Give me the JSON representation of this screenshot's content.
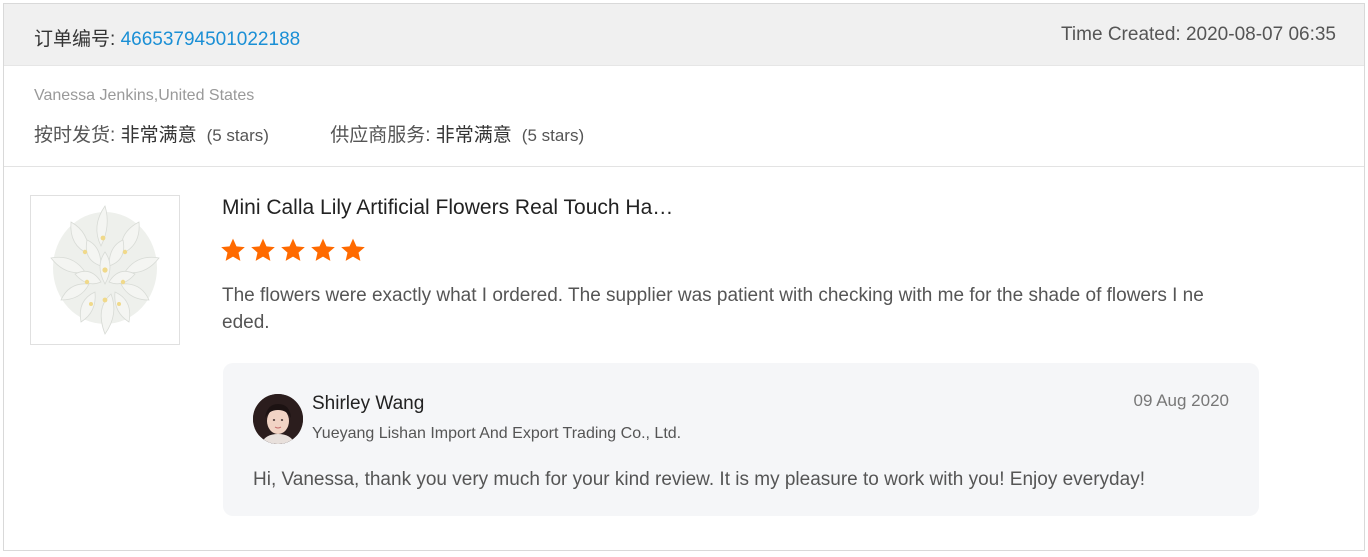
{
  "order": {
    "label": "订单编号: ",
    "number": "46653794501022188",
    "time_created": "Time Created: 2020-08-07 06:35"
  },
  "buyer": {
    "name_location": "Vanessa Jenkins,United States",
    "ratings": [
      {
        "label": "按时发货: ",
        "value": "非常满意",
        "stars_text": "(5 stars)",
        "stars": 5
      },
      {
        "label": "供应商服务: ",
        "value": "非常满意",
        "stars_text": "(5 stars)",
        "stars": 5
      }
    ]
  },
  "review": {
    "product_title": "Mini Calla Lily Artificial Flowers Real Touch Ha…",
    "star_rating": 5,
    "star_color": "#ff6a00",
    "text": "The flowers were exactly what I ordered.  The supplier was patient with checking with me for the shade of flowers I needed."
  },
  "reply": {
    "name": "Shirley Wang",
    "company": "Yueyang Lishan Import And Export Trading Co., Ltd.",
    "date": "09 Aug 2020",
    "text": "Hi, Vanessa, thank you very much for your kind review. It is my pleasure to work with you!  Enjoy everyday!"
  },
  "colors": {
    "order_number": "#1a8fd5",
    "header_bg": "#f0f0f0",
    "reply_bg": "#f5f6f8"
  },
  "icons": {
    "star": "star-icon",
    "product": "product-image",
    "avatar": "avatar"
  }
}
